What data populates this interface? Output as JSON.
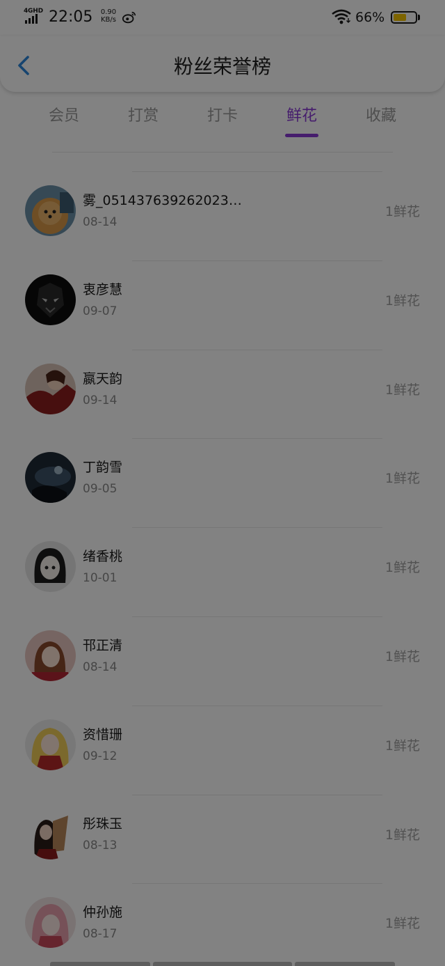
{
  "status_bar": {
    "network": "4GHD",
    "time": "22:05",
    "speed_value": "0.90",
    "speed_unit": "KB/s",
    "battery_text": "66%",
    "battery_level": 0.66,
    "battery_color": "#f5c400"
  },
  "header": {
    "title": "粉丝荣誉榜"
  },
  "tabs": [
    {
      "label": "会员",
      "active": false
    },
    {
      "label": "打赏",
      "active": false
    },
    {
      "label": "打卡",
      "active": false
    },
    {
      "label": "鲜花",
      "active": true
    },
    {
      "label": "收藏",
      "active": false
    }
  ],
  "accent_color": "#8a39d6",
  "fans": [
    {
      "name": "雾_051437639262023…",
      "date": "08-14",
      "value": "1鲜花",
      "avatar_icon": "pomeranian-dog-avatar"
    },
    {
      "name": "衷彦慧",
      "date": "09-07",
      "value": "1鲜花",
      "avatar_icon": "dark-armor-avatar"
    },
    {
      "name": "嬴天韵",
      "date": "09-14",
      "value": "1鲜花",
      "avatar_icon": "anime-warrior-avatar"
    },
    {
      "name": "丁韵雪",
      "date": "09-05",
      "value": "1鲜花",
      "avatar_icon": "dark-scene-avatar"
    },
    {
      "name": "绪香桃",
      "date": "10-01",
      "value": "1鲜花",
      "avatar_icon": "anime-girl-sketch-avatar"
    },
    {
      "name": "邗正清",
      "date": "08-14",
      "value": "1鲜花",
      "avatar_icon": "anime-girl-red-avatar"
    },
    {
      "name": "资惜珊",
      "date": "09-12",
      "value": "1鲜花",
      "avatar_icon": "blonde-anime-avatar"
    },
    {
      "name": "彤珠玉",
      "date": "08-13",
      "value": "1鲜花",
      "avatar_icon": "girl-with-fox-avatar"
    },
    {
      "name": "仲孙施",
      "date": "08-17",
      "value": "1鲜花",
      "avatar_icon": "red-hood-anime-avatar"
    }
  ]
}
